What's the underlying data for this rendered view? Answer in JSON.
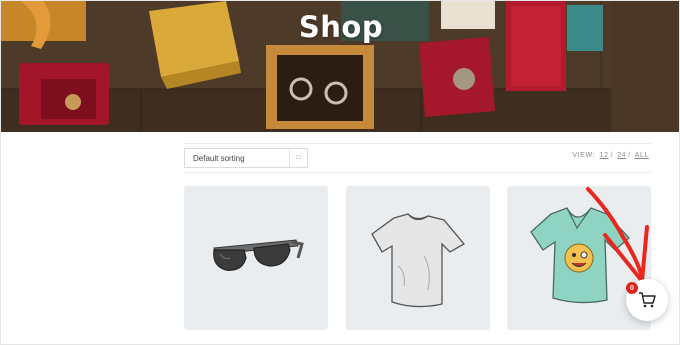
{
  "hero": {
    "title": "Shop"
  },
  "toolbar": {
    "sort_label": "Default sorting",
    "view_label": "VIEW:",
    "view_options": [
      "12",
      "24",
      "ALL"
    ]
  },
  "products": [
    {
      "image": "sunglasses"
    },
    {
      "image": "white-t-shirt"
    },
    {
      "image": "teal-t-shirt-with-emoji"
    }
  ],
  "cart": {
    "count": "0",
    "icon": "cart-icon"
  },
  "colors": {
    "accent_red": "#e2231a",
    "card_bg": "#e9edf0",
    "annotation_arrow": "#e8271d"
  }
}
